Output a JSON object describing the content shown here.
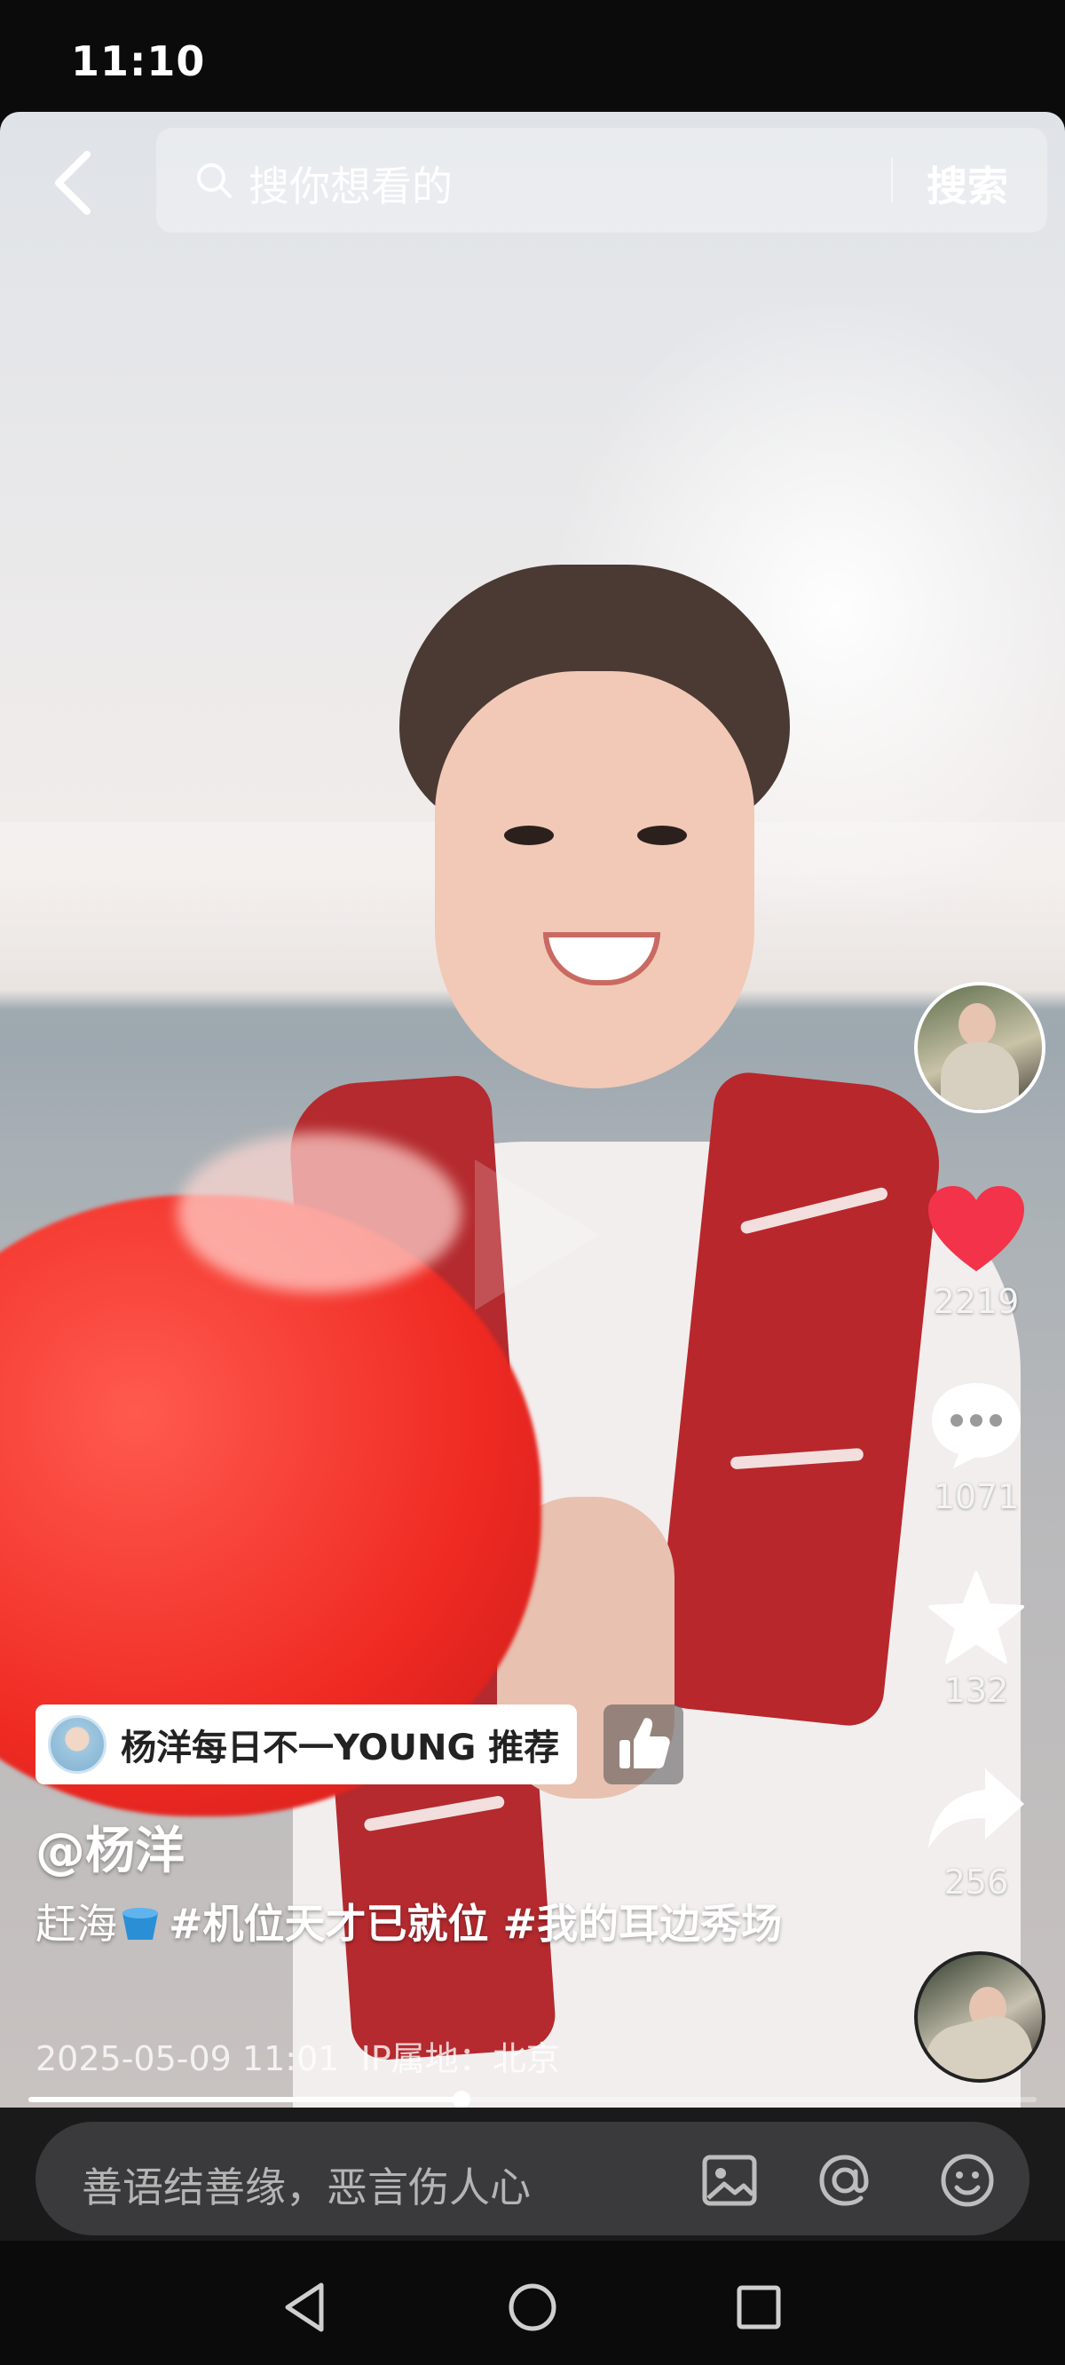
{
  "status_bar": {
    "time": "11:10"
  },
  "search": {
    "placeholder": "搜你想看的",
    "button_label": "搜索"
  },
  "rail": {
    "likes": "2219",
    "comments": "1071",
    "favorites": "132",
    "shares": "256",
    "like_color": "#f2334a"
  },
  "post": {
    "recommend_badge": "杨洋每日不一YOUNG 推荐",
    "author": "@杨洋",
    "caption_prefix": "赶海",
    "caption_tags": "#机位天才已就位 #我的耳边秀场",
    "timestamp": "2025-05-09 11:01",
    "ip_location": "IP属地：北京",
    "progress": 0.43
  },
  "comment_bar": {
    "placeholder": "善语结善缘，恶言伤人心"
  }
}
